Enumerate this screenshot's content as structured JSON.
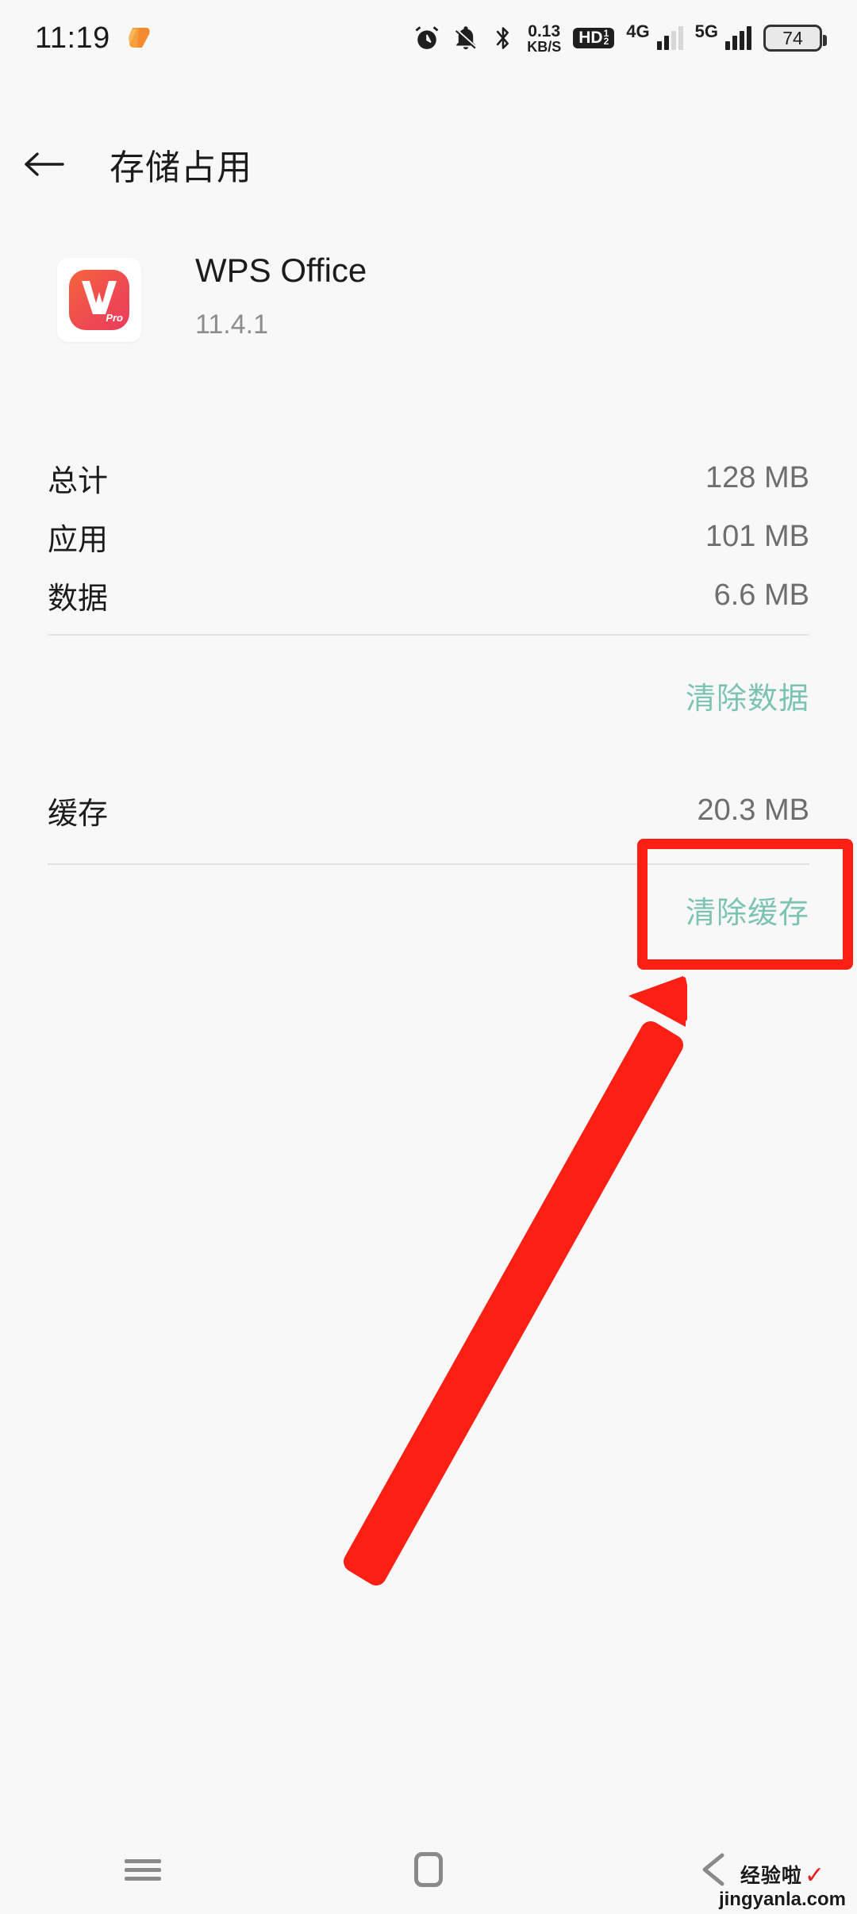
{
  "status_bar": {
    "time": "11:19",
    "logo_icon": "heart-logo-icon",
    "icons": [
      "alarm-icon",
      "notifications-muted-icon",
      "bluetooth-icon"
    ],
    "network_speed_value": "0.13",
    "network_speed_unit": "KB/S",
    "hd_badge": "HD",
    "hd_badge_sup": "1",
    "hd_badge_sub": "2",
    "sim1_gen": "4G",
    "sim2_gen": "5G",
    "battery_percent": "74"
  },
  "header": {
    "back_icon": "back-arrow-icon",
    "title": "存储占用"
  },
  "app": {
    "icon_name": "wps-office-app-icon",
    "icon_badge": "Pro",
    "name": "WPS Office",
    "version": "11.4.1"
  },
  "storage": {
    "rows": [
      {
        "label": "总计",
        "value": "128 MB"
      },
      {
        "label": "应用",
        "value": "101 MB"
      },
      {
        "label": "数据",
        "value": "6.6 MB"
      }
    ],
    "clear_data_label": "清除数据",
    "cache_label": "缓存",
    "cache_value": "20.3 MB",
    "clear_cache_label": "清除缓存"
  },
  "annotation": {
    "highlight_color": "#fc2014",
    "arrow_color": "#fc2014",
    "target": "clear-cache-button"
  },
  "nav_bar": {
    "recents_icon": "menu-icon",
    "home_icon": "home-square-icon",
    "back_icon": "back-triangle-icon"
  },
  "watermark": {
    "brand_cn": "经验啦",
    "check": "✓",
    "url": "jingyanla.com"
  },
  "colors": {
    "background": "#f8f8f8",
    "accent_teal": "#7cc3b2",
    "text_primary": "#1c1c1c",
    "text_secondary": "#6e6e6e",
    "annotation_red": "#fc2014"
  }
}
